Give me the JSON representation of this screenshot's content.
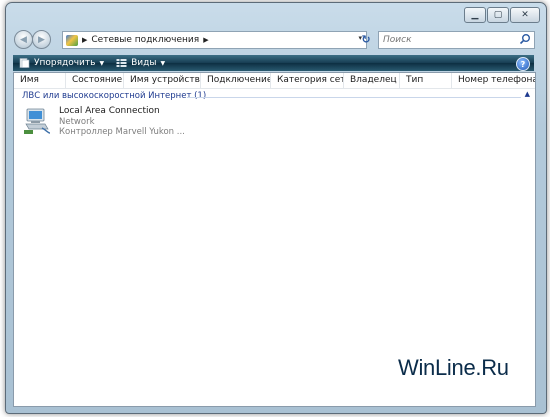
{
  "window": {
    "caption_buttons": {
      "minimize": "▁",
      "maximize": "▢",
      "close": "✕"
    }
  },
  "address_bar": {
    "back_icon": "back-arrow-icon",
    "forward_icon": "forward-arrow-icon",
    "path": "Сетевые подключения",
    "separator": "▶",
    "dropdown": "▾",
    "refresh_icon": "refresh-icon",
    "refresh_glyph": "↻"
  },
  "search": {
    "placeholder": "Поиск"
  },
  "toolbar": {
    "organize_label": "Упорядочить",
    "views_label": "Виды",
    "dropdown_glyph": "▼",
    "help_glyph": "?"
  },
  "columns": [
    "Имя",
    "Состояние",
    "Имя устройства",
    "Подключение",
    "Категория сети",
    "Владелец",
    "Тип",
    "Номер телефона"
  ],
  "group": {
    "label": "ЛВС или высокоскоростной Интернет (1)",
    "collapse_glyph": "▲"
  },
  "items": [
    {
      "name": "Local Area Connection",
      "status": "Network",
      "device": "Контроллер Marvell Yukon ...",
      "icon": "network-connection-icon"
    }
  ],
  "watermark": "WinLine.Ru",
  "colors": {
    "frame": "#b3cadb",
    "toolbar": "#173d52",
    "group_text": "#1e3a8f"
  }
}
